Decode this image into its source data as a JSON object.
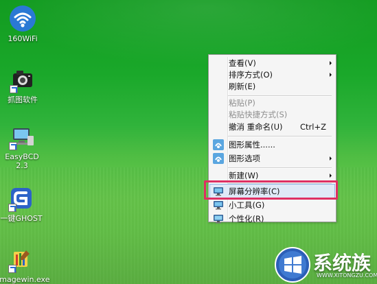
{
  "desktop": {
    "icons": [
      {
        "label": "160WiFi"
      },
      {
        "label": "抓图软件"
      },
      {
        "label": "EasyBCD 2.3"
      },
      {
        "label": "一键GHOST"
      },
      {
        "label": "Imagewin.exe"
      }
    ]
  },
  "context_menu": {
    "items": [
      {
        "label": "查看(V)",
        "submenu": true
      },
      {
        "label": "排序方式(O)",
        "submenu": true
      },
      {
        "label": "刷新(E)"
      },
      {
        "label": "粘贴(P)",
        "disabled": true
      },
      {
        "label": "粘贴快捷方式(S)",
        "disabled": true
      },
      {
        "label": "撤消 重命名(U)",
        "shortcut": "Ctrl+Z"
      },
      {
        "label": "图形属性......",
        "icon": "graphics-properties-icon"
      },
      {
        "label": "图形选项",
        "icon": "graphics-options-icon",
        "submenu": true
      },
      {
        "label": "新建(W)",
        "submenu": true
      },
      {
        "label": "屏幕分辨率(C)",
        "icon": "screen-resolution-icon",
        "highlighted": true
      },
      {
        "label": "小工具(G)",
        "icon": "gadgets-icon"
      },
      {
        "label": "个性化(R)",
        "icon": "personalize-icon"
      }
    ]
  },
  "watermark": {
    "brand": "系统族",
    "url": "WWW.XITONGZU.COM"
  },
  "colors": {
    "highlight_box": "#de2f63",
    "desktop_green": "#1aa82a"
  }
}
